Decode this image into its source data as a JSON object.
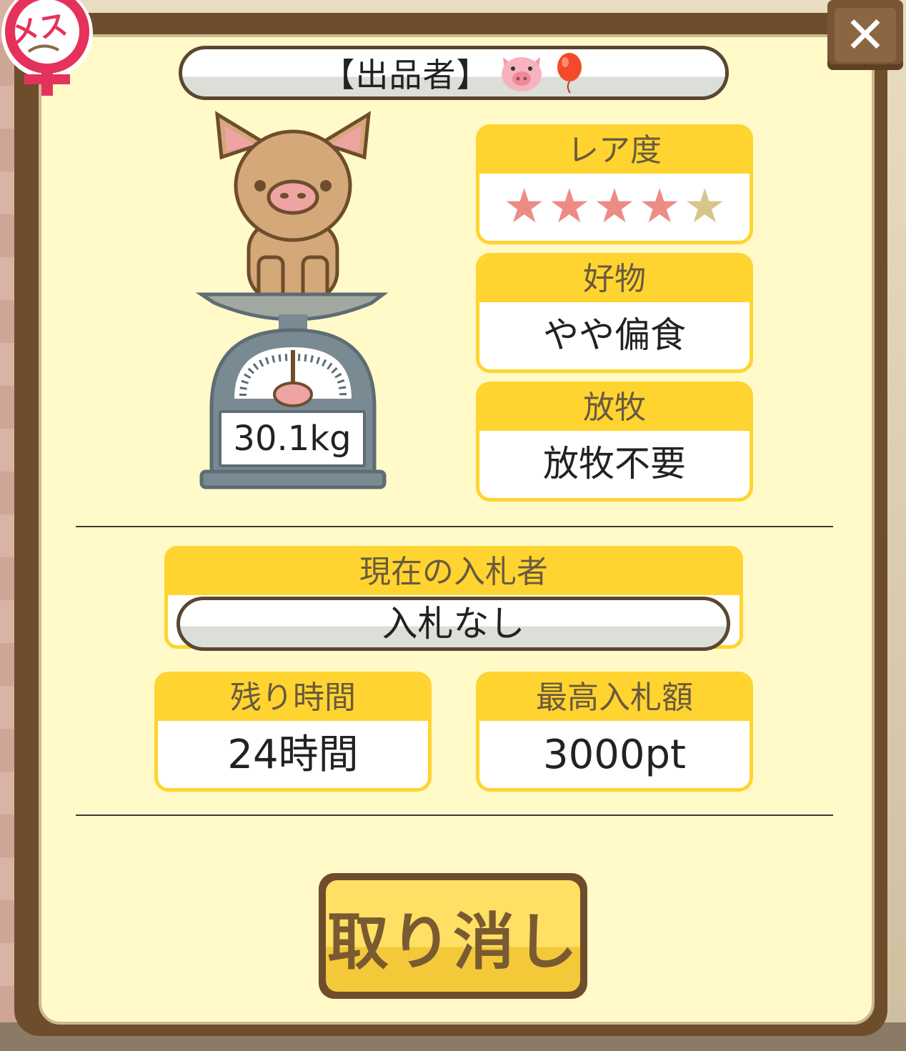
{
  "seller": {
    "label": "【出品者】",
    "icons": [
      "pig-face-icon",
      "balloon-icon"
    ]
  },
  "gender": {
    "label": "メス",
    "symbol": "female-symbol-icon"
  },
  "close": {
    "label": "✕"
  },
  "pig": {
    "weight": "30.1kg"
  },
  "rarity": {
    "title": "レア度",
    "stars_filled": 4,
    "stars_total": 5
  },
  "favorite_food": {
    "title": "好物",
    "value": "やや偏食"
  },
  "grazing": {
    "title": "放牧",
    "value": "放牧不要"
  },
  "current_bidder": {
    "title": "現在の入札者",
    "value": "入札なし"
  },
  "remaining_time": {
    "title": "残り時間",
    "value": "24時間"
  },
  "max_bid": {
    "title": "最高入札額",
    "value": "3000pt"
  },
  "cancel_button": {
    "label": "取り消し"
  },
  "colors": {
    "panel_border": "#6e4d2c",
    "panel_bg": "#fffac8",
    "header_yellow": "#ffd430",
    "star_on": "#ed8b85",
    "star_off": "#d8c58a",
    "gender_red": "#e5325a"
  }
}
